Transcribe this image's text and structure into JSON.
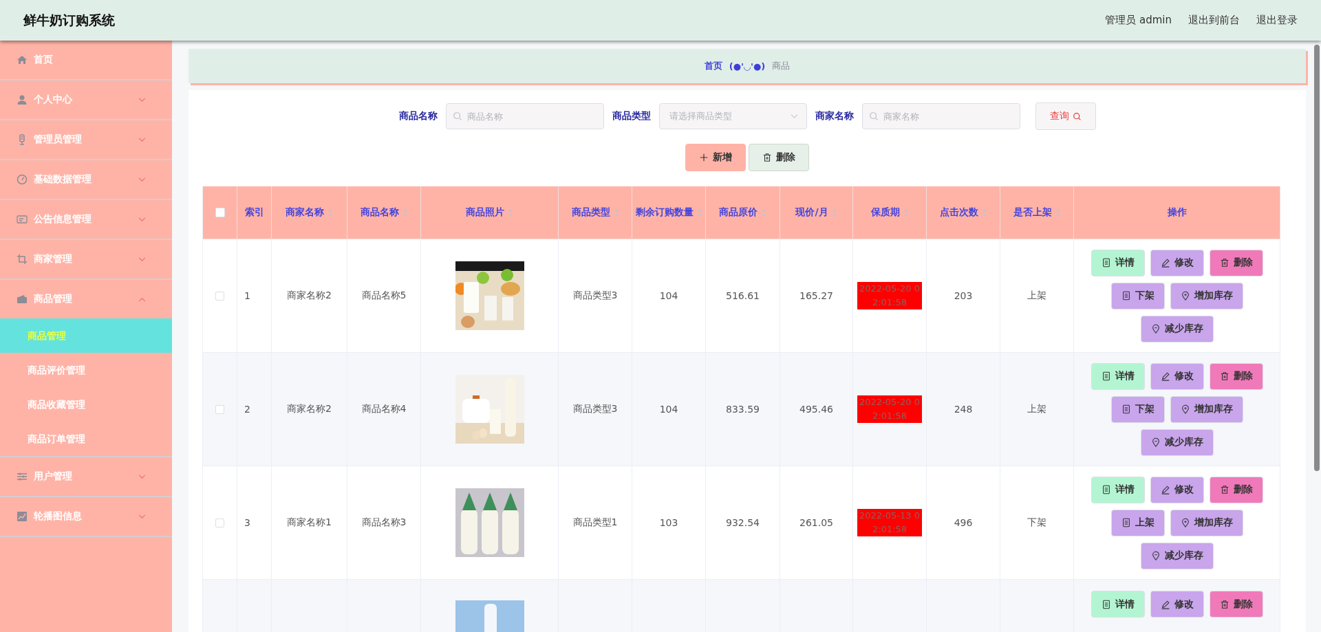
{
  "header": {
    "title": "鲜牛奶订购系统",
    "links": [
      "管理员 admin",
      "退出到前台",
      "退出登录"
    ]
  },
  "sidebar": {
    "items": [
      {
        "label": "首页",
        "kind": "link"
      },
      {
        "label": "个人中心",
        "kind": "menu",
        "expanded": false
      },
      {
        "label": "管理员管理",
        "kind": "menu",
        "expanded": false
      },
      {
        "label": "基础数据管理",
        "kind": "menu",
        "expanded": false
      },
      {
        "label": "公告信息管理",
        "kind": "menu",
        "expanded": false
      },
      {
        "label": "商家管理",
        "kind": "menu",
        "expanded": false
      },
      {
        "label": "商品管理",
        "kind": "menu",
        "expanded": true,
        "children": [
          {
            "label": "商品管理",
            "selected": true
          },
          {
            "label": "商品评价管理",
            "selected": false
          },
          {
            "label": "商品收藏管理",
            "selected": false
          },
          {
            "label": "商品订单管理",
            "selected": false
          }
        ]
      },
      {
        "label": "用户管理",
        "kind": "menu",
        "expanded": false
      },
      {
        "label": "轮播图信息",
        "kind": "menu",
        "expanded": false
      }
    ]
  },
  "breadcrumb": {
    "home": "首页",
    "separator": "(●'◡'●)",
    "current": "商品"
  },
  "search": {
    "fields": [
      {
        "label": "商品名称",
        "kind": "text",
        "placeholder": "商品名称"
      },
      {
        "label": "商品类型",
        "kind": "select",
        "placeholder": "请选择商品类型"
      },
      {
        "label": "商家名称",
        "kind": "text",
        "placeholder": "商家名称"
      }
    ],
    "button": "查询"
  },
  "toolbar": [
    {
      "label": "新增",
      "kind": "add"
    },
    {
      "label": "删除",
      "kind": "delete"
    }
  ],
  "table": {
    "all_selected": false,
    "columns": [
      {
        "label": "索引",
        "sortable": false
      },
      {
        "label": "商家名称",
        "sortable": true
      },
      {
        "label": "商品名称",
        "sortable": true
      },
      {
        "label": "商品照片",
        "sortable": true
      },
      {
        "label": "商品类型",
        "sortable": true
      },
      {
        "label": "剩余订购数量",
        "sortable": true
      },
      {
        "label": "商品原价",
        "sortable": true
      },
      {
        "label": "现价/月",
        "sortable": true
      },
      {
        "label": "保质期",
        "sortable": true
      },
      {
        "label": "点击次数",
        "sortable": true
      },
      {
        "label": "是否上架",
        "sortable": true
      },
      {
        "label": "操作",
        "sortable": false
      }
    ],
    "rows": [
      {
        "selected": false,
        "index": "1",
        "merchant": "商家名称2",
        "name": "商品名称5",
        "photo": {
          "kind": "picture"
        },
        "type": "商品类型3",
        "remaining": "104",
        "price": "516.61",
        "current_price": "165.27",
        "expiry": "2022-05-20 02:01:58",
        "clicks": "203",
        "status": "上架",
        "actions": [
          {
            "label": "详情",
            "kind": "detail"
          },
          {
            "label": "修改",
            "kind": "edit"
          },
          {
            "label": "删除",
            "kind": "delete"
          },
          {
            "label": "下架",
            "kind": "shelf"
          },
          {
            "label": "增加库存",
            "kind": "add_stock"
          },
          {
            "label": "减少库存",
            "kind": "reduce_stock"
          }
        ]
      },
      {
        "selected": false,
        "index": "2",
        "merchant": "商家名称2",
        "name": "商品名称4",
        "photo": {
          "kind": "picture"
        },
        "type": "商品类型3",
        "remaining": "104",
        "price": "833.59",
        "current_price": "495.46",
        "expiry": "2022-05-20 02:01:58",
        "clicks": "248",
        "status": "上架",
        "actions": [
          {
            "label": "详情",
            "kind": "detail"
          },
          {
            "label": "修改",
            "kind": "edit"
          },
          {
            "label": "删除",
            "kind": "delete"
          },
          {
            "label": "下架",
            "kind": "shelf"
          },
          {
            "label": "增加库存",
            "kind": "add_stock"
          },
          {
            "label": "减少库存",
            "kind": "reduce_stock"
          }
        ]
      },
      {
        "selected": false,
        "index": "3",
        "merchant": "商家名称1",
        "name": "商品名称3",
        "photo": {
          "kind": "picture"
        },
        "type": "商品类型1",
        "remaining": "103",
        "price": "932.54",
        "current_price": "261.05",
        "expiry": "2022-05-13 02:01:58",
        "clicks": "496",
        "status": "下架",
        "actions": [
          {
            "label": "详情",
            "kind": "detail"
          },
          {
            "label": "修改",
            "kind": "edit"
          },
          {
            "label": "删除",
            "kind": "delete"
          },
          {
            "label": "上架",
            "kind": "shelf"
          },
          {
            "label": "增加库存",
            "kind": "add_stock"
          },
          {
            "label": "减少库存",
            "kind": "reduce_stock"
          }
        ]
      },
      {
        "photo": {
          "kind": "picture"
        },
        "actions": [
          {
            "label": "详情",
            "kind": "detail"
          },
          {
            "label": "修改",
            "kind": "edit"
          },
          {
            "label": "删除",
            "kind": "delete"
          }
        ]
      }
    ]
  }
}
